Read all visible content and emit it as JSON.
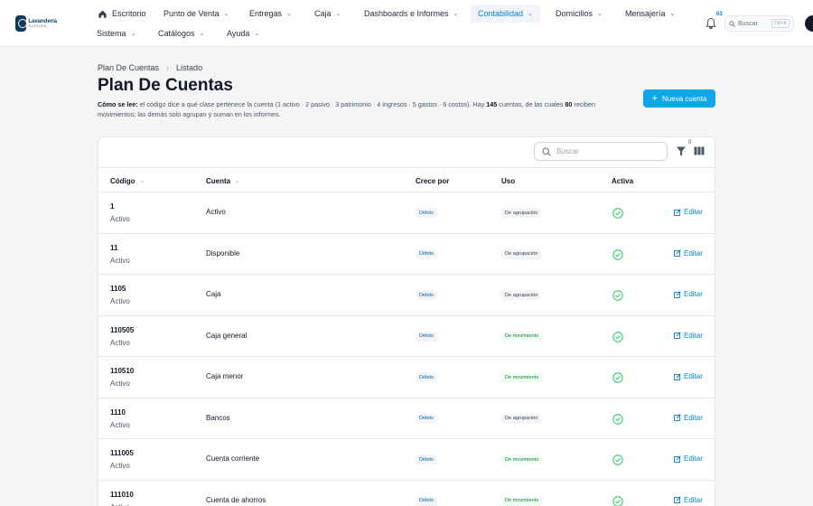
{
  "brand": {
    "name": "Lavandería",
    "sub": "AURORA"
  },
  "nav": {
    "row1": [
      {
        "label": "Escritorio",
        "icon": "home-icon"
      },
      {
        "label": "Punto de Venta"
      },
      {
        "label": "Entregas"
      },
      {
        "label": "Caja"
      },
      {
        "label": "Dashboards e Informes"
      },
      {
        "label": "Contabilidad",
        "active": true
      },
      {
        "label": "Domicilios"
      },
      {
        "label": "Mensajería"
      }
    ],
    "row2": [
      {
        "label": "Sistema"
      },
      {
        "label": "Catálogos"
      },
      {
        "label": "Ayuda"
      }
    ]
  },
  "header": {
    "notification_count": "63",
    "search_label": "Buscar",
    "search_shortcut": "Ctrl+K"
  },
  "breadcrumb": {
    "parent": "Plan De Cuentas",
    "current": "Listado"
  },
  "page": {
    "title": "Plan De Cuentas",
    "desc_lead": "Cómo se lee:",
    "desc_part1": "el código dice a qué clase pertenece la cuenta (1 activo · 2 pasivo · 3 patrimonio · 4 ingresos · 5 gastos · 6 costos). Hay",
    "desc_count": "145",
    "desc_part2": "cuentas, de las cuales",
    "desc_group": "80",
    "desc_part3": "reciben movimientos; las demás solo agrupan y suman en los informes.",
    "new_button": "Nueva cuenta"
  },
  "table": {
    "search_placeholder": "Buscar",
    "filter_count": "0",
    "headers": {
      "code": "Código",
      "account": "Cuenta",
      "grows_by": "Crece por",
      "use": "Uso",
      "active": "Activa"
    },
    "edit_label": "Editar",
    "rows": [
      {
        "code": "1",
        "class": "Activo",
        "name": "Activo",
        "grows": "Débito",
        "use": "De agrupación",
        "use_type": "group"
      },
      {
        "code": "11",
        "class": "Activo",
        "name": "Disponible",
        "grows": "Débito",
        "use": "De agrupación",
        "use_type": "group"
      },
      {
        "code": "1105",
        "class": "Activo",
        "name": "Caja",
        "grows": "Débito",
        "use": "De agrupación",
        "use_type": "group"
      },
      {
        "code": "110505",
        "class": "Activo",
        "name": "Caja general",
        "grows": "Débito",
        "use": "De movimiento",
        "use_type": "move"
      },
      {
        "code": "110510",
        "class": "Activo",
        "name": "Caja menor",
        "grows": "Débito",
        "use": "De movimiento",
        "use_type": "move"
      },
      {
        "code": "1110",
        "class": "Activo",
        "name": "Bancos",
        "grows": "Débito",
        "use": "De agrupación",
        "use_type": "group"
      },
      {
        "code": "111005",
        "class": "Activo",
        "name": "Cuenta corriente",
        "grows": "Débito",
        "use": "De movimiento",
        "use_type": "move"
      },
      {
        "code": "111010",
        "class": "Activo",
        "name": "Cuenta de ahorros",
        "grows": "Débito",
        "use": "De movimiento",
        "use_type": "move"
      }
    ]
  },
  "colors": {
    "accent": "#0ea5e9",
    "link": "#0284c7",
    "success": "#22c55e"
  }
}
